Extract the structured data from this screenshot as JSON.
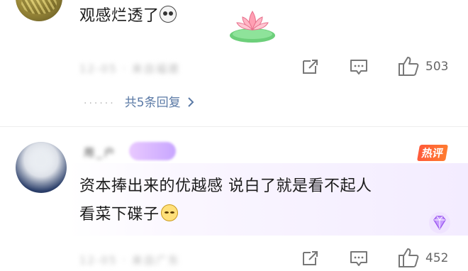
{
  "comment1": {
    "text": "观感烂透了",
    "emoji_icon": "shocked-face-icon",
    "sticker_icon": "lotus-sticker-icon",
    "meta_blurred": "12-05 · 来自福建",
    "actions": {
      "share_icon": "share-icon",
      "comment_icon": "comment-icon",
      "like_icon": "thumbs-up-icon",
      "like_count": "503"
    },
    "replies_label": "共5条回复",
    "replies_dots": "······"
  },
  "comment2": {
    "username_blurred": "用_户",
    "hot_badge": "热评",
    "line1": "资本捧出来的优越感 说白了就是看不起人",
    "line2": "看菜下碟子",
    "emoji_icon": "sweat-face-icon",
    "gem_icon": "gem-icon",
    "meta_blurred": "12-05 · 来自广东",
    "actions": {
      "like_count": "452"
    }
  },
  "colors": {
    "reply_link": "#5b7aa6",
    "hot_badge": "#ff5a3a",
    "highlight": "#f3ecff"
  }
}
